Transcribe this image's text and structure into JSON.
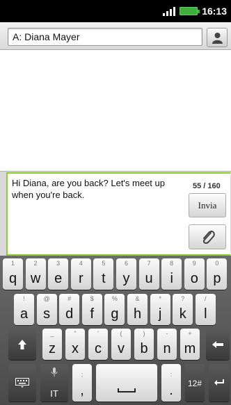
{
  "status_bar": {
    "time": "16:13"
  },
  "recipient": {
    "value": "A: Diana Mayer"
  },
  "compose": {
    "message": "Hi Diana, are you back? Let's meet up when you're back.",
    "counter": "55 / 160",
    "send_label": "Invia"
  },
  "keyboard": {
    "row1": [
      {
        "k": "q",
        "h": "1"
      },
      {
        "k": "w",
        "h": "2"
      },
      {
        "k": "e",
        "h": "3"
      },
      {
        "k": "r",
        "h": "4"
      },
      {
        "k": "t",
        "h": "5"
      },
      {
        "k": "y",
        "h": "6"
      },
      {
        "k": "u",
        "h": "7"
      },
      {
        "k": "i",
        "h": "8"
      },
      {
        "k": "o",
        "h": "9"
      },
      {
        "k": "p",
        "h": "0"
      }
    ],
    "row2": [
      {
        "k": "a",
        "h": "!"
      },
      {
        "k": "s",
        "h": "@"
      },
      {
        "k": "d",
        "h": "#"
      },
      {
        "k": "f",
        "h": "$"
      },
      {
        "k": "g",
        "h": "%"
      },
      {
        "k": "h",
        "h": "&"
      },
      {
        "k": "j",
        "h": "*"
      },
      {
        "k": "k",
        "h": "?"
      },
      {
        "k": "l",
        "h": "/"
      }
    ],
    "row3": [
      {
        "k": "z",
        "h": "_"
      },
      {
        "k": "x",
        "h": "\""
      },
      {
        "k": "c",
        "h": "'"
      },
      {
        "k": "v",
        "h": "("
      },
      {
        "k": "b",
        "h": ")"
      },
      {
        "k": "n",
        "h": "-"
      },
      {
        "k": "m",
        "h": "+"
      }
    ],
    "lang_label": "IT",
    "comma": ",",
    "comma_hint": ";",
    "period": ".",
    "period_hint": ":",
    "symbols_label": "12#"
  }
}
